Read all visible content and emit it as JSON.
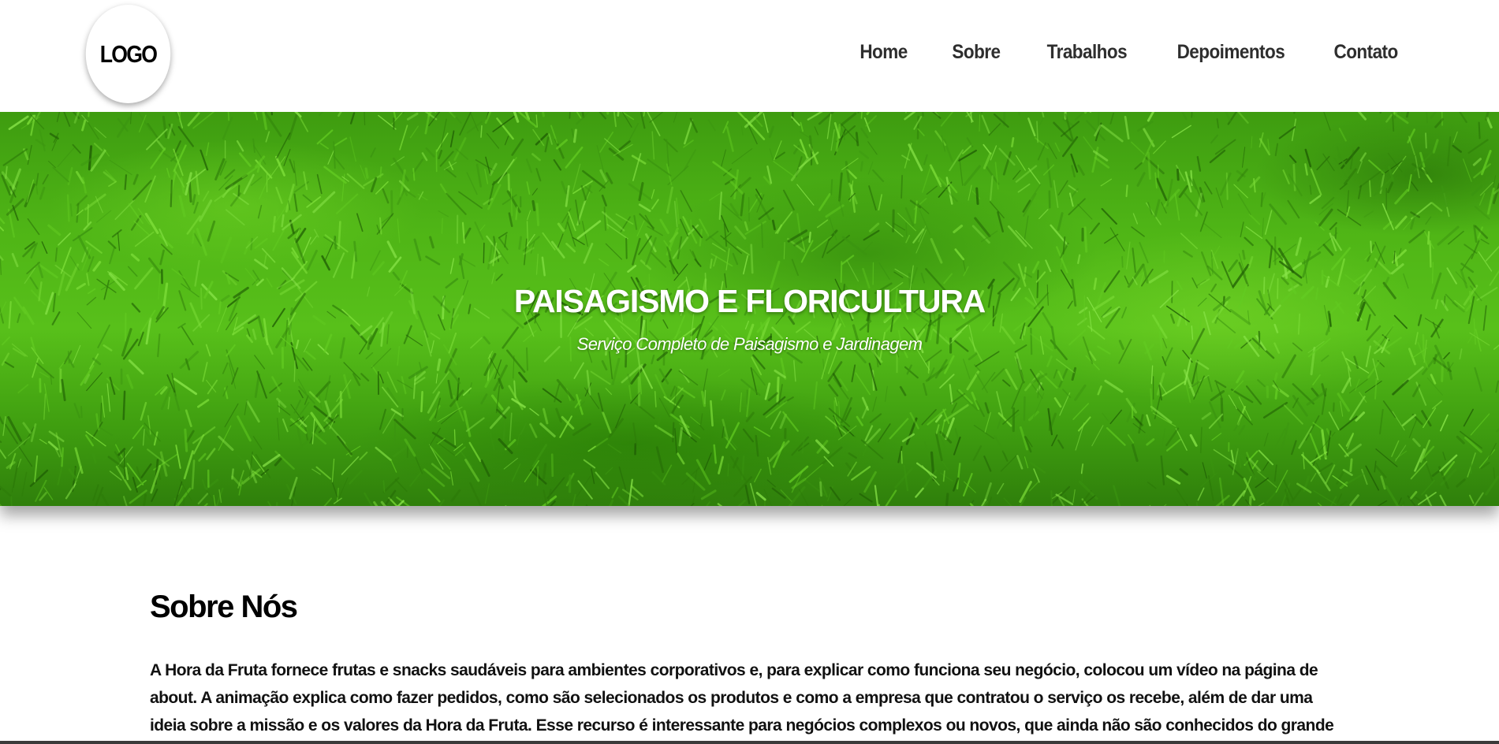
{
  "header": {
    "logo_text": "LOGO",
    "nav": [
      {
        "label": "Home"
      },
      {
        "label": "Sobre"
      },
      {
        "label": "Trabalhos"
      },
      {
        "label": "Depoimentos"
      },
      {
        "label": "Contato"
      }
    ]
  },
  "hero": {
    "title": "PAISAGISMO E FLORICULTURA",
    "subtitle": "Serviço Completo de Paisagismo e Jardinagem",
    "background": "grass"
  },
  "about": {
    "heading": "Sobre Nós",
    "body": "A Hora da Fruta fornece frutas e snacks saudáveis para ambientes corporativos e, para explicar como funciona seu negócio, colocou um vídeo na página de about. A animação explica como fazer pedidos, como são selecionados os produtos e como a empresa que contratou o serviço os recebe, além de dar uma ideia sobre a missão e os valores da Hora da Fruta. Esse recurso é interessante para negócios complexos ou novos, que ainda não são conhecidos do grande público. A animação"
  },
  "colors": {
    "nav_text": "#2e2e2e",
    "hero_green": "#4fb516",
    "heading": "#000000"
  }
}
